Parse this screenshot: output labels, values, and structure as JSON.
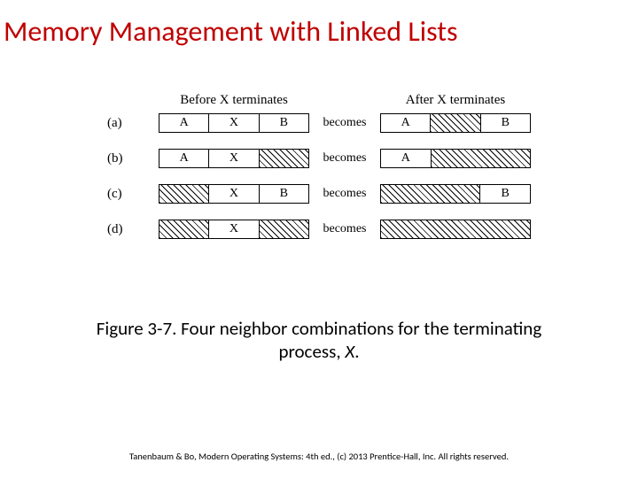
{
  "title": "Memory Management with Linked Lists",
  "header_before": "Before X terminates",
  "header_after": "After X terminates",
  "becomes": "becomes",
  "rows": [
    {
      "label": "(a)",
      "before": [
        "A",
        "X",
        "B"
      ],
      "after": [
        "A",
        "",
        "B"
      ],
      "after_hatch": [
        false,
        true,
        false
      ]
    },
    {
      "label": "(b)",
      "before": [
        "A",
        "X",
        ""
      ],
      "hatch": [
        false,
        false,
        true
      ],
      "after": [
        "A",
        ""
      ],
      "after_hatch": [
        false,
        true
      ],
      "after_widths": [
        1,
        2
      ]
    },
    {
      "label": "(c)",
      "before": [
        "",
        "X",
        "B"
      ],
      "hatch": [
        true,
        false,
        false
      ],
      "after": [
        "",
        "B"
      ],
      "after_hatch": [
        true,
        false
      ],
      "after_widths": [
        2,
        1
      ]
    },
    {
      "label": "(d)",
      "before": [
        "",
        "X",
        ""
      ],
      "hatch": [
        true,
        false,
        true
      ],
      "after": [
        ""
      ],
      "after_hatch": [
        true
      ],
      "after_widths": [
        3
      ]
    }
  ],
  "caption_a": "Figure 3-7. Four neighbor combinations for the terminating process, ",
  "caption_x": "X",
  "caption_b": ".",
  "credit": "Tanenbaum & Bo, Modern Operating Systems: 4th ed., (c) 2013 Prentice-Hall, Inc. All rights reserved."
}
